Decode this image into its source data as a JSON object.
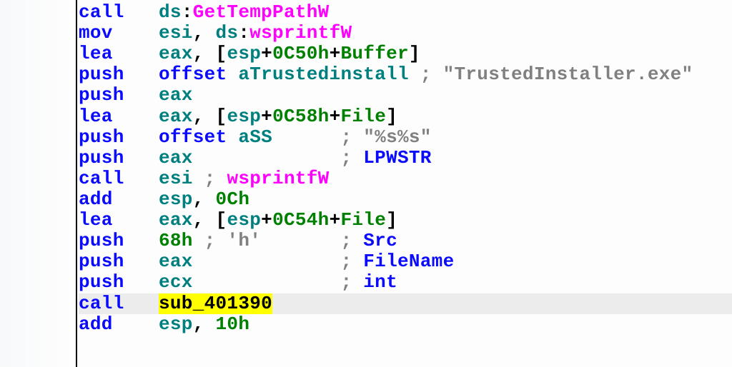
{
  "lines": [
    {
      "mn": "call",
      "parts": [
        {
          "t": "ds",
          "c": "op"
        },
        {
          "t": ":",
          "c": "pl"
        },
        {
          "t": "GetTempPathW",
          "c": "api"
        }
      ]
    },
    {
      "mn": "mov",
      "parts": [
        {
          "t": "esi",
          "c": "op"
        },
        {
          "t": ", ",
          "c": "pl"
        },
        {
          "t": "ds",
          "c": "op"
        },
        {
          "t": ":",
          "c": "pl"
        },
        {
          "t": "wsprintfW",
          "c": "api"
        }
      ]
    },
    {
      "mn": "lea",
      "parts": [
        {
          "t": "eax",
          "c": "op"
        },
        {
          "t": ", [",
          "c": "pl"
        },
        {
          "t": "esp",
          "c": "op"
        },
        {
          "t": "+",
          "c": "pl"
        },
        {
          "t": "0C50h",
          "c": "num"
        },
        {
          "t": "+",
          "c": "pl"
        },
        {
          "t": "Buffer",
          "c": "num"
        },
        {
          "t": "]",
          "c": "pl"
        }
      ]
    },
    {
      "mn": "push",
      "parts": [
        {
          "t": "offset",
          "c": "sym"
        },
        {
          "t": " ",
          "c": "pl"
        },
        {
          "t": "aTrustedinstall",
          "c": "op"
        },
        {
          "t": " ",
          "c": "pl"
        },
        {
          "t": "; ",
          "c": "cmt"
        },
        {
          "t": "\"TrustedInstaller.exe\"",
          "c": "cmt"
        }
      ]
    },
    {
      "mn": "push",
      "parts": [
        {
          "t": "eax",
          "c": "op"
        }
      ]
    },
    {
      "mn": "lea",
      "parts": [
        {
          "t": "eax",
          "c": "op"
        },
        {
          "t": ", [",
          "c": "pl"
        },
        {
          "t": "esp",
          "c": "op"
        },
        {
          "t": "+",
          "c": "pl"
        },
        {
          "t": "0C58h",
          "c": "num"
        },
        {
          "t": "+",
          "c": "pl"
        },
        {
          "t": "File",
          "c": "num"
        },
        {
          "t": "]",
          "c": "pl"
        }
      ]
    },
    {
      "mn": "push",
      "parts": [
        {
          "t": "offset",
          "c": "sym"
        },
        {
          "t": " ",
          "c": "pl"
        },
        {
          "t": "aSS",
          "c": "op"
        }
      ],
      "pad": "      ",
      "cmt": "; ",
      "cmt2": "\"%s%s\""
    },
    {
      "mn": "push",
      "parts": [
        {
          "t": "eax",
          "c": "op"
        }
      ],
      "pad": "             ",
      "cmt": "; ",
      "cmt2": "LPWSTR",
      "cmt2c": "sym"
    },
    {
      "mn": "call",
      "parts": [
        {
          "t": "esi",
          "c": "op"
        },
        {
          "t": " ",
          "c": "pl"
        },
        {
          "t": "; ",
          "c": "cmt"
        },
        {
          "t": "wsprintfW",
          "c": "api"
        }
      ]
    },
    {
      "mn": "add",
      "parts": [
        {
          "t": "esp",
          "c": "op"
        },
        {
          "t": ", ",
          "c": "pl"
        },
        {
          "t": "0Ch",
          "c": "num"
        }
      ]
    },
    {
      "mn": "lea",
      "parts": [
        {
          "t": "eax",
          "c": "op"
        },
        {
          "t": ", [",
          "c": "pl"
        },
        {
          "t": "esp",
          "c": "op"
        },
        {
          "t": "+",
          "c": "pl"
        },
        {
          "t": "0C54h",
          "c": "num"
        },
        {
          "t": "+",
          "c": "pl"
        },
        {
          "t": "File",
          "c": "num"
        },
        {
          "t": "]",
          "c": "pl"
        }
      ]
    },
    {
      "mn": "push",
      "parts": [
        {
          "t": "68h",
          "c": "num"
        },
        {
          "t": " ",
          "c": "pl"
        },
        {
          "t": "; 'h'",
          "c": "cmt"
        }
      ],
      "pad": "       ",
      "cmt": "; ",
      "cmt2": "Src",
      "cmt2c": "sym"
    },
    {
      "mn": "push",
      "parts": [
        {
          "t": "eax",
          "c": "op"
        }
      ],
      "pad": "             ",
      "cmt": "; ",
      "cmt2": "FileName",
      "cmt2c": "sym"
    },
    {
      "mn": "push",
      "parts": [
        {
          "t": "ecx",
          "c": "op"
        }
      ],
      "pad": "             ",
      "cmt": "; ",
      "cmt2": "int",
      "cmt2c": "sym"
    },
    {
      "mn": "call",
      "hl": true,
      "parts": [
        {
          "t": "sub_401390",
          "c": "pl",
          "hlt": true
        }
      ]
    },
    {
      "mn": "add",
      "parts": [
        {
          "t": "esp",
          "c": "op"
        },
        {
          "t": ", ",
          "c": "pl"
        },
        {
          "t": "10h",
          "c": "num"
        }
      ]
    }
  ]
}
